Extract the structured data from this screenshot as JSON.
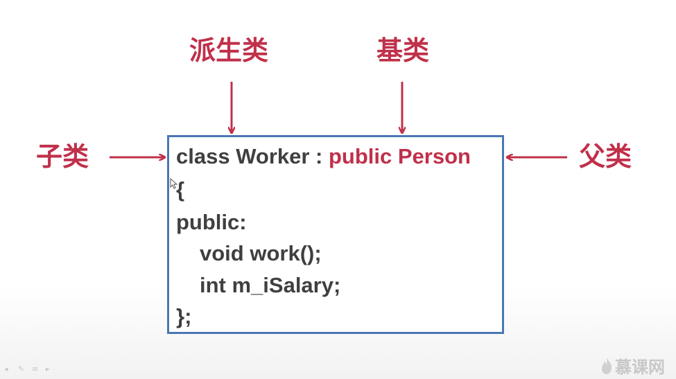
{
  "labels": {
    "derived": "派生类",
    "base": "基类",
    "subclass": "子类",
    "parent": "父类"
  },
  "code": {
    "line1_class": "class Worker : ",
    "line1_inherit": "public Person",
    "line2": "{",
    "line3": "public:",
    "line4": "void work();",
    "line5": "int m_iSalary;",
    "line6": "};"
  },
  "watermark": {
    "text": "慕课网"
  },
  "colors": {
    "accent": "#c0304a",
    "box_border": "#4a77b4",
    "code_text": "#3f3f3f"
  },
  "icons": [
    "arrow-down-icon",
    "arrow-right-icon",
    "arrow-left-icon",
    "flame-logo-icon",
    "mouse-cursor-icon"
  ]
}
